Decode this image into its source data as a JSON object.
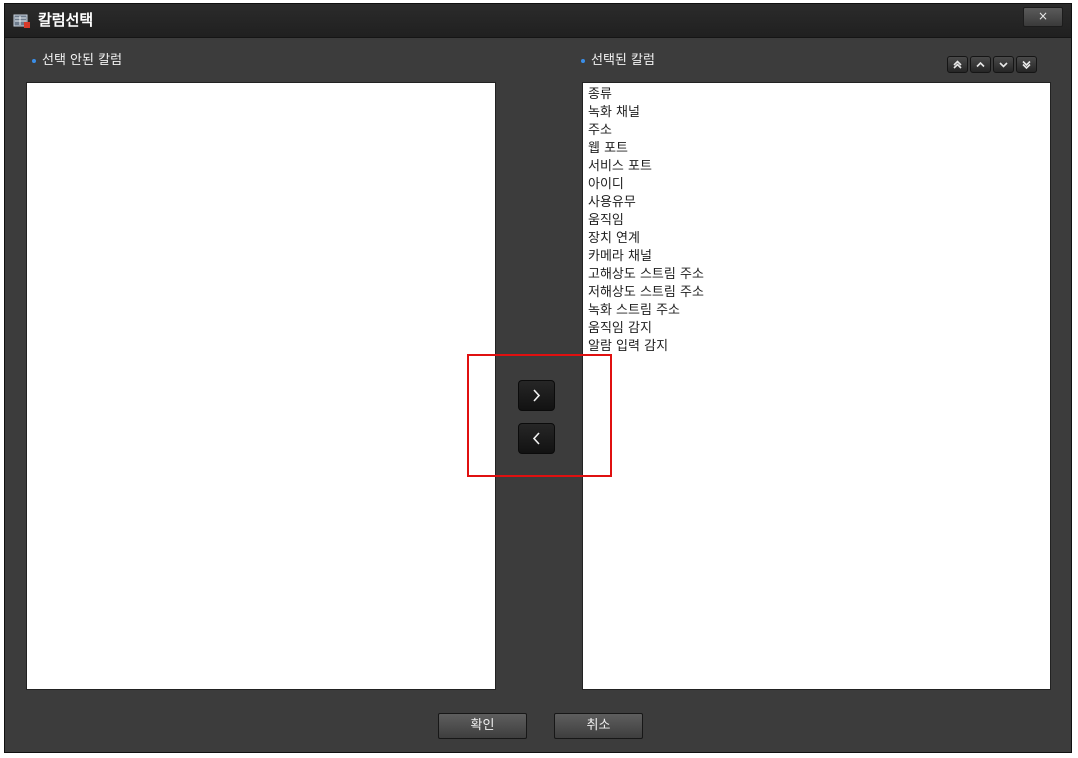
{
  "window": {
    "title": "칼럼선택",
    "close_label": "×"
  },
  "left_panel": {
    "label": "선택 안된 칼럼",
    "items": []
  },
  "right_panel": {
    "label": "선택된 칼럼",
    "items": [
      "종류",
      "녹화 채널",
      "주소",
      "웹 포트",
      "서비스 포트",
      "아이디",
      "사용유무",
      "움직임",
      "장치 연계",
      "카메라 채널",
      "고해상도 스트림 주소",
      "저해상도 스트림 주소",
      "녹화 스트림 주소",
      "움직임 감지",
      "알람 입력 감지"
    ]
  },
  "order_buttons": [
    "move-top-icon",
    "move-up-icon",
    "move-down-icon",
    "move-bottom-icon"
  ],
  "move_buttons": {
    "add_icon": "chevron-right-icon",
    "remove_icon": "chevron-left-icon"
  },
  "footer": {
    "ok_label": "확인",
    "cancel_label": "취소"
  },
  "colors": {
    "background": "#3c3c3c",
    "titlebar": "#202020",
    "label_dot": "#3a8ee8",
    "highlight": "#e01010"
  }
}
